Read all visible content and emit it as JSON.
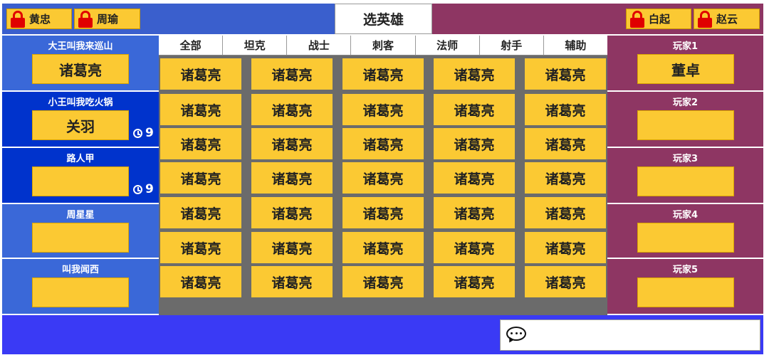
{
  "title": "选英雄",
  "bans_left": [
    "黄忠",
    "周瑜"
  ],
  "bans_right": [
    "白起",
    "赵云"
  ],
  "tabs": [
    "全部",
    "坦克",
    "战士",
    "刺客",
    "法师",
    "射手",
    "辅助"
  ],
  "left_team": [
    {
      "name": "大王叫我来巡山",
      "hero": "诸葛亮",
      "timer": ""
    },
    {
      "name": "小王叫我吃火锅",
      "hero": "关羽",
      "timer": "9"
    },
    {
      "name": "路人甲",
      "hero": "",
      "timer": "9"
    },
    {
      "name": "周星星",
      "hero": "",
      "timer": ""
    },
    {
      "name": "叫我闻西",
      "hero": "",
      "timer": ""
    }
  ],
  "right_team": [
    {
      "name": "玩家1",
      "hero": "董卓"
    },
    {
      "name": "玩家2",
      "hero": ""
    },
    {
      "name": "玩家3",
      "hero": ""
    },
    {
      "name": "玩家4",
      "hero": ""
    },
    {
      "name": "玩家5",
      "hero": ""
    }
  ],
  "heroes": [
    "诸葛亮",
    "诸葛亮",
    "诸葛亮",
    "诸葛亮",
    "诸葛亮",
    "诸葛亮",
    "诸葛亮",
    "诸葛亮",
    "诸葛亮",
    "诸葛亮",
    "诸葛亮",
    "诸葛亮",
    "诸葛亮",
    "诸葛亮",
    "诸葛亮",
    "诸葛亮",
    "诸葛亮",
    "诸葛亮",
    "诸葛亮",
    "诸葛亮",
    "诸葛亮",
    "诸葛亮",
    "诸葛亮",
    "诸葛亮",
    "诸葛亮",
    "诸葛亮",
    "诸葛亮",
    "诸葛亮",
    "诸葛亮",
    "诸葛亮",
    "诸葛亮",
    "诸葛亮",
    "诸葛亮",
    "诸葛亮",
    "诸葛亮"
  ],
  "chat": {
    "text": ""
  },
  "colors": {
    "left_team": "#3a68d8",
    "left_active": "#0033cc",
    "right_team": "#8e3663",
    "slot": "#fbc933",
    "bottom": "#3a3af5"
  }
}
